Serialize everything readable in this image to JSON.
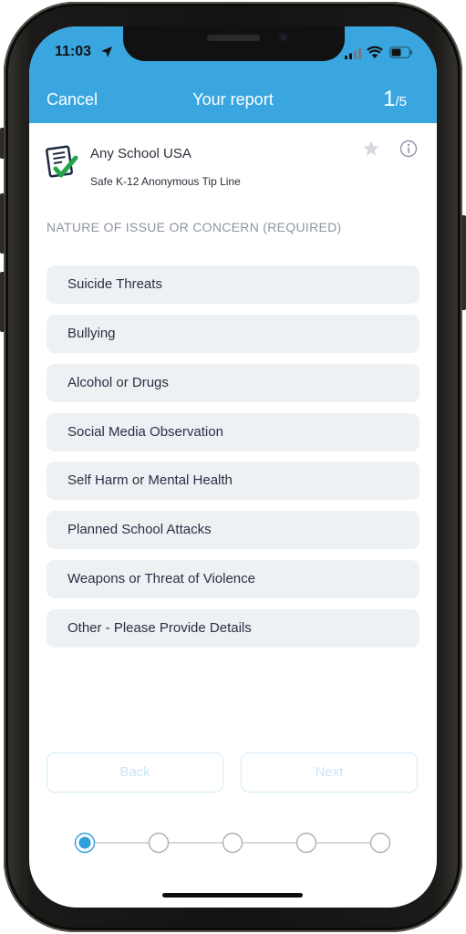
{
  "status": {
    "time": "11:03"
  },
  "nav": {
    "cancel": "Cancel",
    "title": "Your report",
    "step_current": "1",
    "step_sep": "/",
    "step_total": "5"
  },
  "school": {
    "name": "Any School USA",
    "subtitle": "Safe K-12 Anonymous Tip Line"
  },
  "section_label": "NATURE OF ISSUE OR CONCERN (REQUIRED)",
  "options": [
    "Suicide Threats",
    "Bullying",
    "Alcohol or Drugs",
    "Social Media Observation",
    "Self Harm or Mental Health",
    "Planned School Attacks",
    "Weapons or Threat of Violence",
    "Other - Please Provide Details"
  ],
  "buttons": {
    "back": "Back",
    "next": "Next"
  },
  "progress": {
    "steps": 5,
    "current": 1
  },
  "colors": {
    "header": "#3aa6e0",
    "option_bg": "#eef1f4",
    "progress_active": "#2f9fdc",
    "progress_inactive": "#c8ccd2",
    "disabled_button": "#c8e6f5"
  },
  "icons": {
    "location": "location-arrow-icon",
    "signal": "cellular-signal-icon",
    "wifi": "wifi-icon",
    "battery": "battery-icon",
    "logo": "document-check-icon",
    "favorite": "star-icon",
    "info": "info-icon"
  }
}
